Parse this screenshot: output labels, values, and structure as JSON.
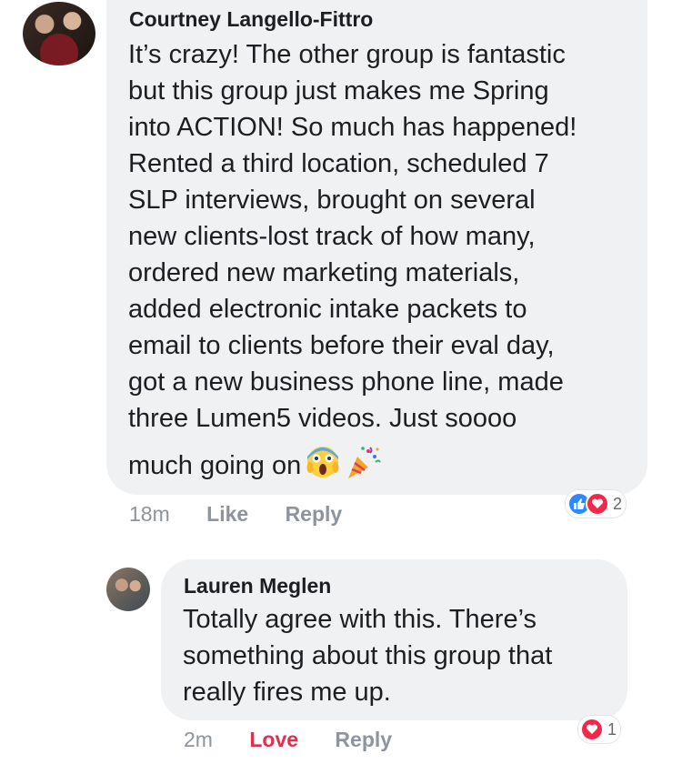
{
  "comment1": {
    "author": "Courtney Langello-Fittro",
    "lines": [
      "It’s crazy! The other group is fantastic",
      "but this group just makes me Spring",
      "into ACTION! So much has happened!",
      "Rented a third location, scheduled 7",
      "SLP interviews, brought on several",
      "new clients-lost track of how many,",
      "ordered new marketing materials,",
      "added electronic intake packets to",
      "email to clients before their eval day,",
      "got a new business phone line, made",
      "three Lumen5 videos. Just soooo"
    ],
    "last_line": "much going on",
    "emojis": [
      "scream-emoji",
      "party-popper-emoji"
    ],
    "time": "18m",
    "like_label": "Like",
    "reply_label": "Reply",
    "reactions": [
      "like-reaction-icon",
      "love-reaction-icon"
    ],
    "reaction_count": "2"
  },
  "comment2": {
    "author": "Lauren Meglen",
    "lines": [
      "Totally agree with this. There’s",
      "something about this group that",
      "really fires me up."
    ],
    "time": "2m",
    "love_label": "Love",
    "reply_label": "Reply",
    "reactions": [
      "love-reaction-icon"
    ],
    "reaction_count": "1"
  },
  "colors": {
    "bubble": "#f0f1f3",
    "love_text": "#e0304e",
    "like_blue": "#2d88ff",
    "love_red": "#f0284a"
  }
}
